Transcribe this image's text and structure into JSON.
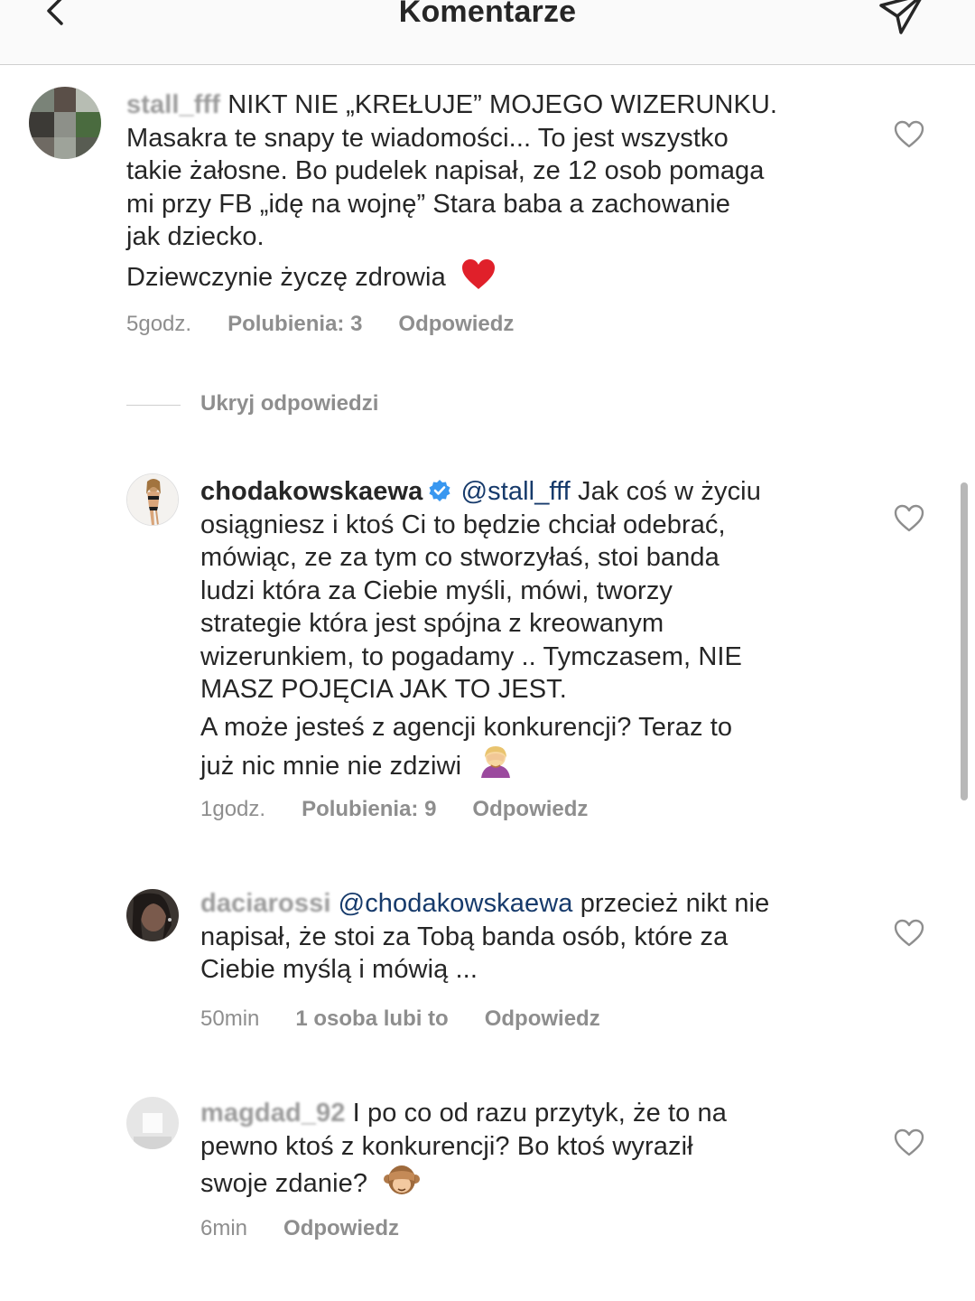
{
  "header": {
    "title": "Komentarze"
  },
  "comments": [
    {
      "username": "stall_fff",
      "lines": [
        "NIKT NIE „KREŁUJE” MOJEGO WIZERUNKU.",
        "Masakra te snapy te wiadomości... To jest wszystko",
        "takie żałosne. Bo pudelek napisał, ze 12 osob pomaga",
        "mi przy FB „idę na wojnę” Stara baba a zachowanie",
        "jak dziecko."
      ],
      "second_paragraph": "Dziewczynie życzę zdrowia",
      "time": "5godz.",
      "likes": "Polubienia: 3",
      "reply": "Odpowiedz"
    }
  ],
  "hide_replies": "Ukryj odpowiedzi",
  "replies": [
    {
      "username": "chodakowskaewa",
      "mention": "@stall_fff",
      "lines": [
        "Jak coś w życiu",
        "osiągniesz i ktoś Ci to będzie chciał odebrać,",
        "mówiąc, ze za tym co stworzyłaś, stoi banda",
        "ludzi która za Ciebie myśli, mówi, tworzy",
        "strategie która jest spójna z kreowanym",
        "wizerunkiem, to pogadamy .. Tymczasem, NIE",
        "MASZ POJĘCIA JAK TO JEST."
      ],
      "second_paragraph": [
        "A może jesteś z agencji konkurencji? Teraz to",
        "już nic mnie nie zdziwi"
      ],
      "time": "1godz.",
      "likes": "Polubienia: 9",
      "reply": "Odpowiedz"
    },
    {
      "username": "daciarossi",
      "mention": "@chodakowskaewa",
      "lines": [
        "przecież nikt nie",
        "napisał, że stoi za Tobą banda osób, które za",
        "Ciebie myślą i mówią ..."
      ],
      "time": "50min",
      "likes": "1 osoba lubi to",
      "reply": "Odpowiedz"
    },
    {
      "username": "magdad_92",
      "lines": [
        "I po co od razu przytyk, że to na",
        "pewno ktoś z konkurencji? Bo ktoś wyraził",
        "swoje zdanie?"
      ],
      "time": "6min",
      "reply": "Odpowiedz"
    }
  ],
  "icons": {
    "back": "chevron-left-icon",
    "send": "paper-plane-icon",
    "like": "heart-outline-icon",
    "verified": "verified-badge-icon",
    "heart_emoji": "red-heart-emoji",
    "facepalm_emoji": "woman-facepalming-emoji",
    "see_no_evil_emoji": "see-no-evil-monkey-emoji"
  },
  "colors": {
    "text": "#262626",
    "meta": "#8e8e8e",
    "mention": "#163a6b",
    "verified": "#3897f0",
    "heart_emoji": "#e0202a"
  }
}
